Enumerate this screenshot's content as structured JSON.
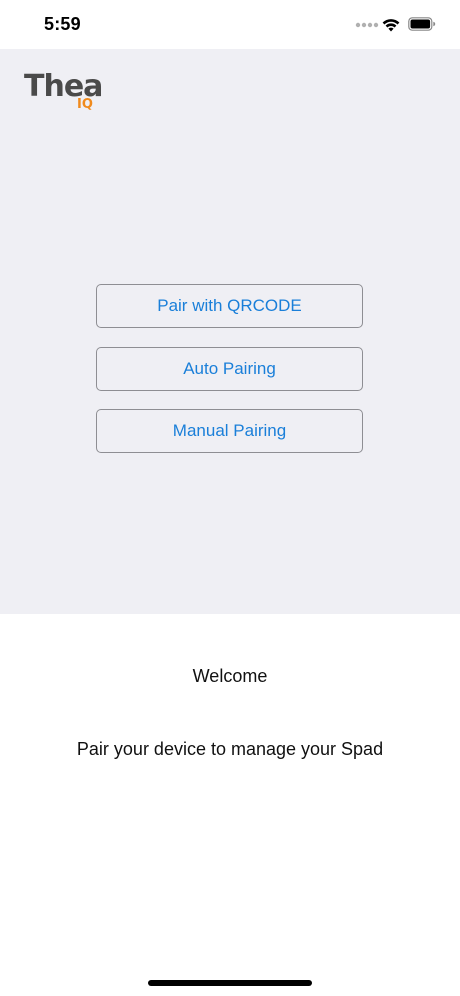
{
  "status_bar": {
    "time": "5:59",
    "signal_icon": "signal-dots-icon",
    "wifi_icon": "wifi-icon",
    "battery_icon": "battery-icon"
  },
  "logo": {
    "main_text": "Thea",
    "sub_text": "IQ",
    "main_color": "#4a4a4a",
    "accent_color": "#f08a1c"
  },
  "pairing_options": {
    "qrcode_label": "Pair with QRCODE",
    "auto_label": "Auto Pairing",
    "manual_label": "Manual Pairing",
    "button_text_color": "#1a7fd9"
  },
  "welcome": {
    "title": "Welcome",
    "message": "Pair your device to manage your Spad"
  },
  "colors": {
    "panel_background": "#efeff4",
    "page_background": "#ffffff"
  }
}
